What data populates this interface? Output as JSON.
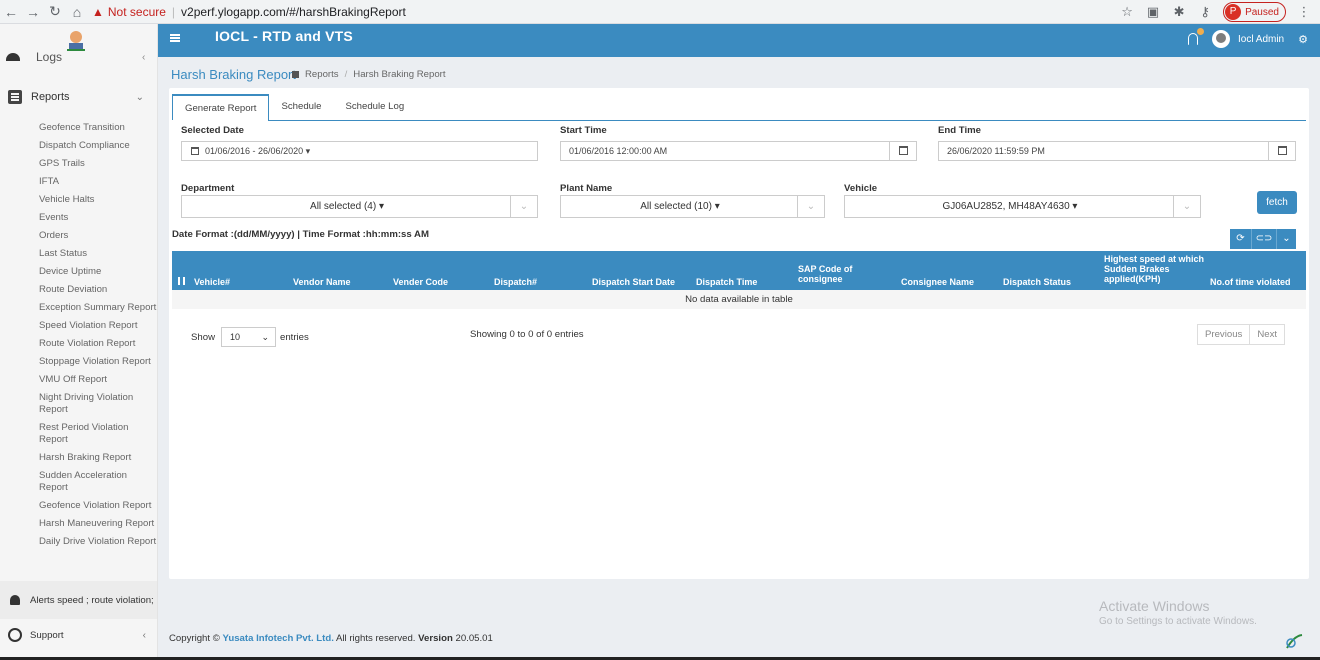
{
  "browser": {
    "nav_icons": [
      "back-arrow-icon",
      "forward-arrow-icon",
      "reload-icon",
      "home-icon"
    ],
    "security_label": "Not secure",
    "url": "v2perf.ylogapp.com/#/harshBrakingReport",
    "paused_initial": "P",
    "paused_label": "Paused",
    "accent_color": "#d93025"
  },
  "header": {
    "title": "IOCL - RTD and VTS",
    "user_name": "Iocl Admin",
    "bar_color": "#3b8bc0"
  },
  "sidebar": {
    "logs_label": "Logs",
    "reports_label": "Reports",
    "report_items": [
      "Geofence Transition",
      "Dispatch Compliance",
      "GPS Trails",
      "IFTA",
      "Vehicle Halts",
      "Events",
      "Orders",
      "Last Status",
      "Device Uptime",
      "Route Deviation",
      "Exception Summary Report",
      "Speed Violation Report",
      "Route Violation Report",
      "Stoppage Violation Report",
      "VMU Off Report",
      "Night Driving Violation Report",
      "Rest Period Violation Report",
      "Harsh Braking Report",
      "Sudden Acceleration Report",
      "Geofence Violation Report",
      "Harsh Maneuvering Report",
      "Daily Drive Violation Report"
    ],
    "alerts_label": "Alerts speed ; route violation;",
    "support_label": "Support"
  },
  "page": {
    "title": "Harsh Braking Report",
    "breadcrumb": [
      "Reports",
      "Harsh Braking Report"
    ]
  },
  "tabs": [
    "Generate Report",
    "Schedule",
    "Schedule Log"
  ],
  "filters": {
    "selected_date_label": "Selected Date",
    "selected_date_value": "01/06/2016 - 26/06/2020 ▾",
    "start_time_label": "Start Time",
    "start_time_value": "01/06/2016 12:00:00 AM",
    "end_time_label": "End Time",
    "end_time_value": "26/06/2020 11:59:59 PM",
    "department_label": "Department",
    "department_value": "All selected (4) ▾",
    "plant_label": "Plant Name",
    "plant_value": "All selected (10) ▾",
    "vehicle_label": "Vehicle",
    "vehicle_value": "GJ06AU2852, MH48AY4630 ▾",
    "fetch_label": "fetch"
  },
  "format_note": "Date Format :(dd/MM/yyyy) | Time Format :hh:mm:ss AM",
  "table": {
    "columns": [
      "Vehicle#",
      "Vendor Name",
      "Vender Code",
      "Dispatch#",
      "Dispatch Start Date",
      "Dispatch Time",
      "SAP Code of consignee",
      "Consignee Name",
      "Dispatch Status",
      "Highest speed at which Sudden Brakes applied(KPH)",
      "No.of time violated"
    ],
    "empty_message": "No data available in table"
  },
  "pagination": {
    "show_label": "Show",
    "page_size": "10",
    "entries_label": "entries",
    "info": "Showing 0 to 0 of 0 entries",
    "previous": "Previous",
    "next": "Next"
  },
  "watermark": {
    "line1": "Activate Windows",
    "line2": "Go to Settings to activate Windows."
  },
  "footer": {
    "prefix": "Copyright ©",
    "company": "Yusata Infotech Pvt. Ltd.",
    "rights": "All rights reserved.",
    "version_label": "Version",
    "version": "20.05.01"
  }
}
